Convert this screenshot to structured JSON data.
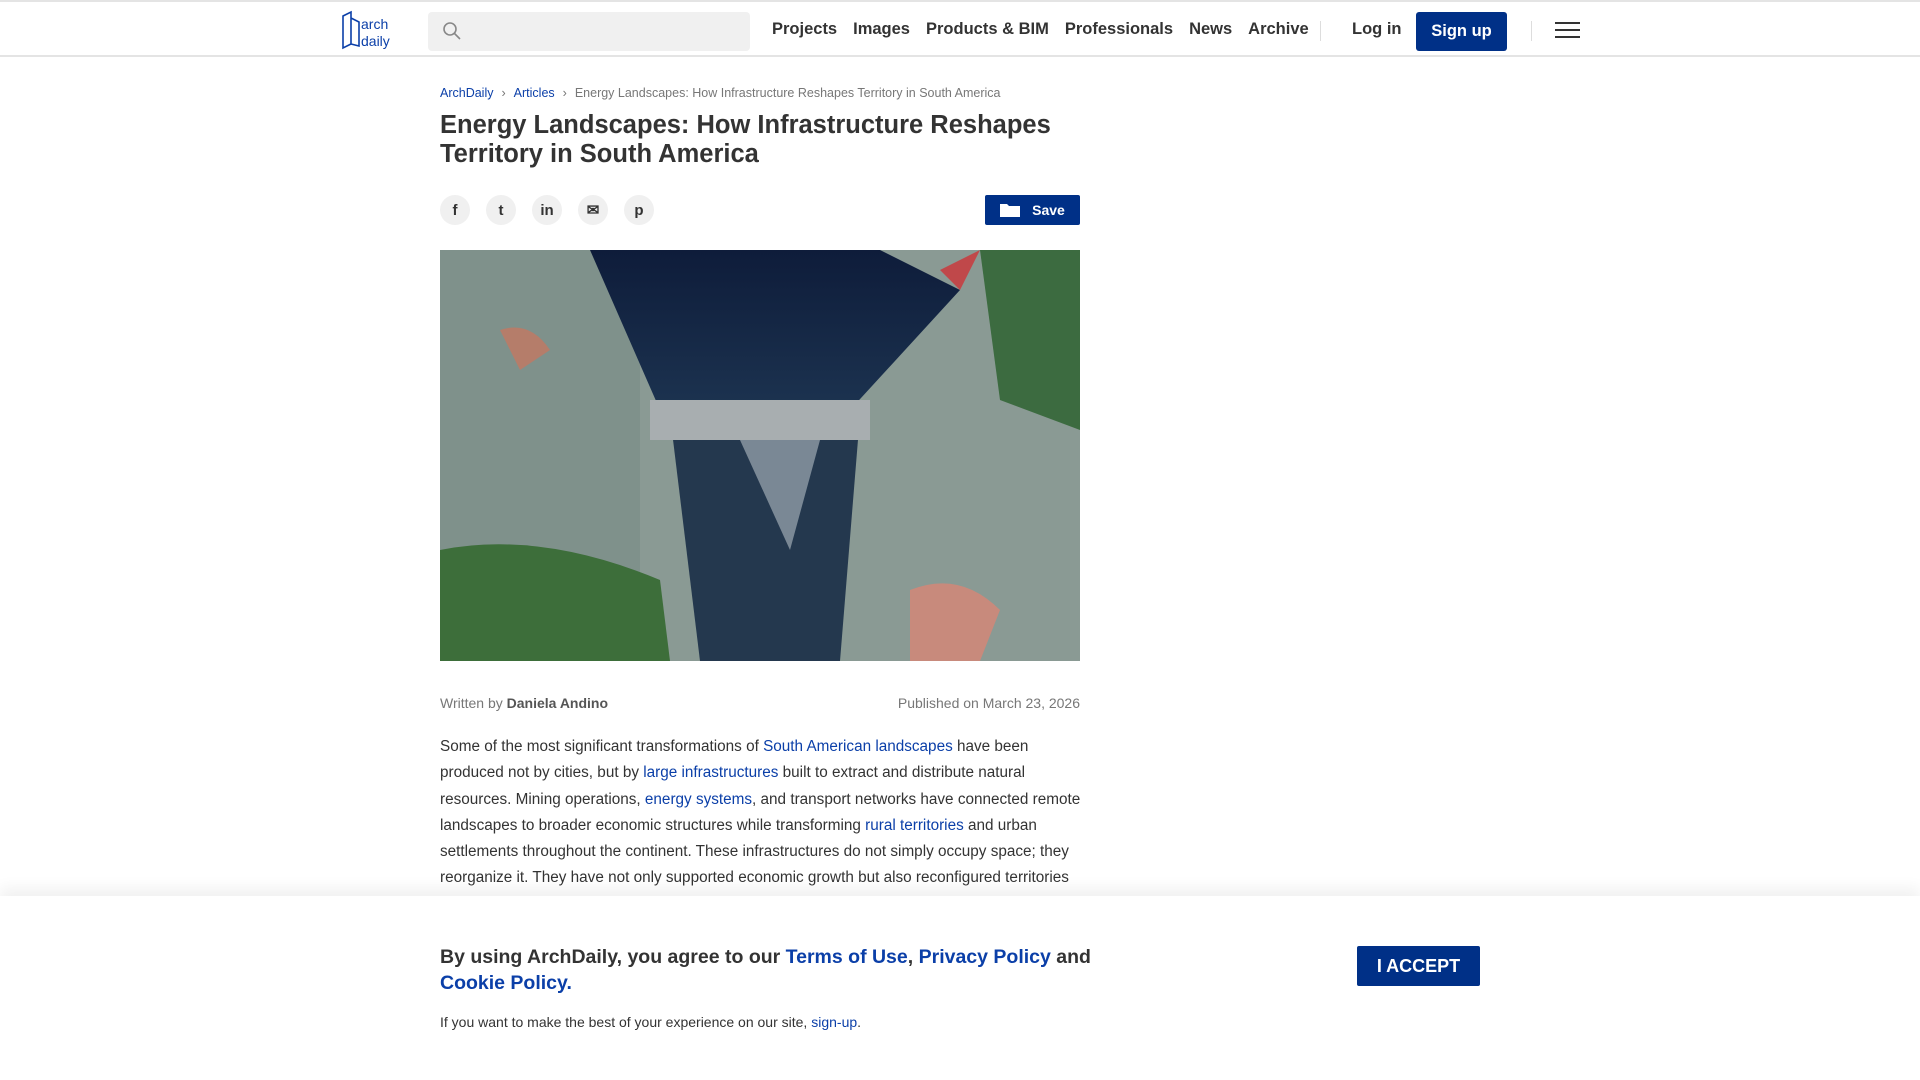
{
  "header": {
    "nav": [
      "Projects",
      "Images",
      "Products & BIM",
      "Professionals",
      "News",
      "Archive"
    ],
    "login": "Log in",
    "signup": "Sign up",
    "search_placeholder": ""
  },
  "breadcrumb": [
    "ArchDaily",
    "Articles",
    "Energy Landscapes: How Infrastructure Reshapes Territory in South America"
  ],
  "title": "Energy Landscapes: How Infrastructure Reshapes Territory in South America",
  "social": {
    "facebook": "f",
    "twitter": "t",
    "linkedin": "in",
    "email": "✉",
    "pinterest": "p"
  },
  "save_label": "Save",
  "byline": {
    "written_by": "Written by",
    "author": "Daniela Andino",
    "published": "Published on March 23, 2026"
  },
  "body": {
    "t1": "Some of the most significant transformations of ",
    "l1": "South American landscapes",
    "t2": " have been produced not by cities, but by ",
    "l2": "large infrastructures",
    "t3": " built to extract and distribute natural resources. Mining operations, ",
    "l3": "energy systems",
    "t4": ", and transport networks have connected remote landscapes to broader economic structures while transforming ",
    "l4": "rural territories",
    "t5": " and urban settlements throughout the continent. These infrastructures do not simply occupy space; they reorganize it. They have not only supported economic growth but also reconfigured territories in"
  },
  "cookie": {
    "t1": "By using ArchDaily, you agree to our ",
    "terms": "Terms of Use",
    "comma": ", ",
    "privacy": "Privacy Policy",
    "and": " and ",
    "cookie": "Cookie Policy",
    "dot": ".",
    "sub": "If you want to make the best of your experience on our site, ",
    "signup": "sign-up",
    "sub_end": ".",
    "accept": "I ACCEPT"
  }
}
